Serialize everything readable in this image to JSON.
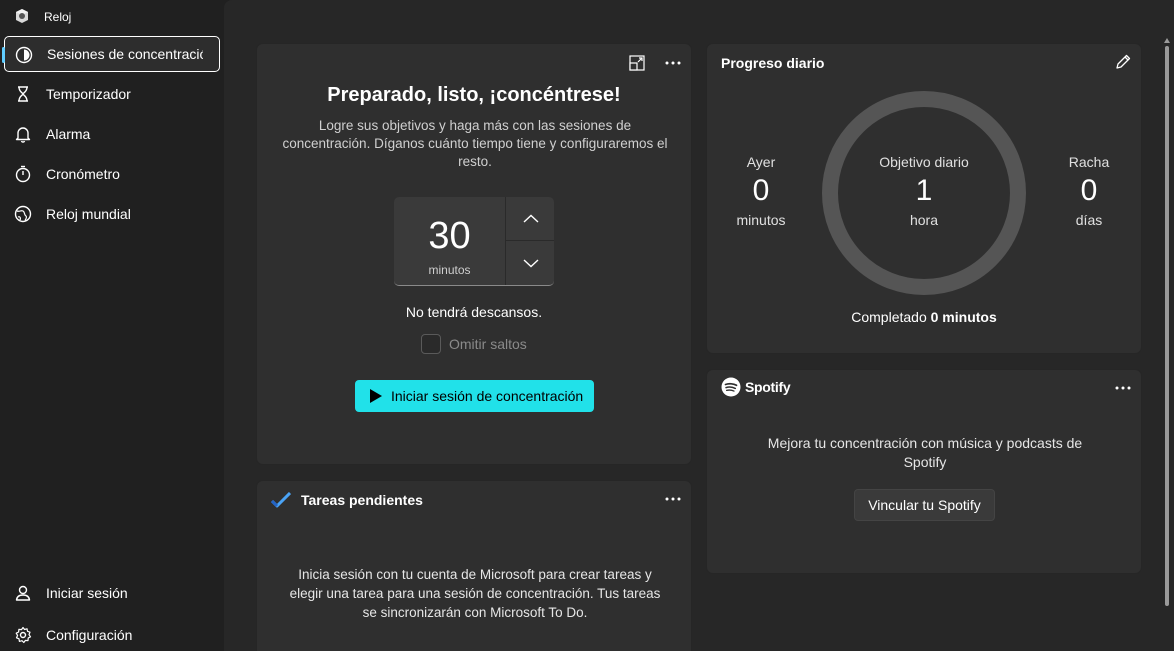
{
  "window": {
    "title": "Reloj"
  },
  "sidebar": {
    "items": [
      {
        "label": "Sesiones de concentració",
        "icon": "focus-icon"
      },
      {
        "label": "Temporizador",
        "icon": "hourglass-icon"
      },
      {
        "label": "Alarma",
        "icon": "bell-icon"
      },
      {
        "label": "Cronómetro",
        "icon": "stopwatch-icon"
      },
      {
        "label": "Reloj mundial",
        "icon": "globe-icon"
      }
    ],
    "footer": [
      {
        "label": "Iniciar sesión",
        "icon": "person-icon"
      },
      {
        "label": "Configuración",
        "icon": "gear-icon"
      }
    ]
  },
  "focus": {
    "title": "Preparado, listo, ¡concéntrese!",
    "description": "Logre sus objetivos y haga más con las sesiones de concentración. Díganos cuánto tiempo tiene y configuraremos el resto.",
    "minutes_value": "30",
    "minutes_unit": "minutos",
    "breaks_text": "No tendrá descansos.",
    "skip_label": "Omitir saltos",
    "skip_checked": false,
    "start_label": "Iniciar sesión de concentración",
    "accent": "#21e1e9"
  },
  "tasks": {
    "title": "Tareas pendientes",
    "text": "Inicia sesión con tu cuenta de Microsoft para crear tareas y elegir una tarea para una sesión de concentración. Tus tareas se sincronizarán con Microsoft To Do."
  },
  "progress": {
    "title": "Progreso diario",
    "yesterday": {
      "label": "Ayer",
      "value": "0",
      "unit": "minutos"
    },
    "goal": {
      "label": "Objetivo diario",
      "value": "1",
      "unit": "hora"
    },
    "streak": {
      "label": "Racha",
      "value": "0",
      "unit": "días"
    },
    "completed_prefix": "Completado",
    "completed_value": "0 minutos",
    "completion_fraction": 0
  },
  "spotify": {
    "brand": "Spotify",
    "text": "Mejora tu concentración con música y podcasts de Spotify",
    "link_label": "Vincular tu Spotify"
  }
}
